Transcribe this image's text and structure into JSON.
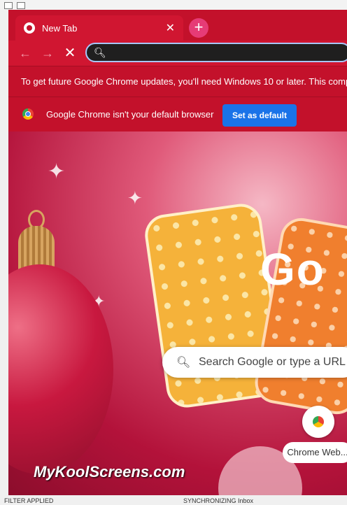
{
  "tab": {
    "title": "New Tab",
    "close": "✕"
  },
  "newtab": {
    "label": "+"
  },
  "nav": {
    "back": "←",
    "forward": "→",
    "stop": "✕"
  },
  "omnibox": {
    "value": ""
  },
  "banner": {
    "text": "To get future Google Chrome updates, you'll need Windows 10 or later. This comp"
  },
  "infobar": {
    "text": "Google Chrome isn't your default browser",
    "button": "Set as default"
  },
  "ntp": {
    "logo_text": "Go",
    "search_placeholder": "Search Google or type a URL",
    "shortcut_label": "Chrome Web..."
  },
  "watermark": "MyKoolScreens.com",
  "host": {
    "left_status": "FILTER APPLIED",
    "right_status": "SYNCHRONIZING   Inbox"
  },
  "icons": {
    "search": "search-icon",
    "chrome": "chrome-logo-icon"
  }
}
